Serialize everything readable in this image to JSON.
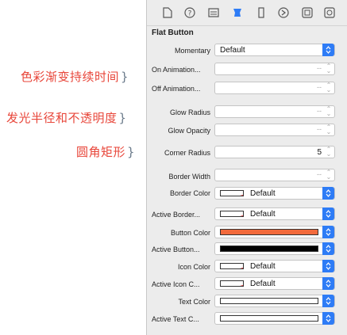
{
  "annotations": {
    "fade_duration": "色彩渐变持续时间",
    "glow_radius_opacity": "发光半径和不透明度",
    "corner_radius": "圆角矩形"
  },
  "toolbar": {
    "icons": [
      "file-icon",
      "help-icon",
      "identity-icon",
      "attributes-icon",
      "size-icon",
      "connections-icon",
      "bindings-icon",
      "effects-icon"
    ]
  },
  "section": {
    "title": "Flat Button"
  },
  "rows": {
    "momentary": {
      "label": "Momentary",
      "value": "Default"
    },
    "on_animation": {
      "label": "On Animation..."
    },
    "off_animation": {
      "label": "Off Animation..."
    },
    "glow_radius": {
      "label": "Glow Radius"
    },
    "glow_opacity": {
      "label": "Glow Opacity"
    },
    "corner_radius": {
      "label": "Corner Radius",
      "value": "5"
    },
    "border_width": {
      "label": "Border Width"
    },
    "border_color": {
      "label": "Border Color",
      "value": "Default"
    },
    "active_border": {
      "label": "Active Border...",
      "value": "Default"
    },
    "button_color": {
      "label": "Button Color",
      "color": "#f26a3c"
    },
    "active_button": {
      "label": "Active Button...",
      "color": "#000000"
    },
    "icon_color": {
      "label": "Icon Color",
      "value": "Default"
    },
    "active_icon": {
      "label": "Active Icon C...",
      "value": "Default"
    },
    "text_color": {
      "label": "Text Color",
      "color": "#ffffff"
    },
    "active_text": {
      "label": "Active Text C...",
      "color": "#ffffff"
    }
  },
  "colors": {
    "accent": "#2e7cf6",
    "annotation": "#e8463a"
  }
}
